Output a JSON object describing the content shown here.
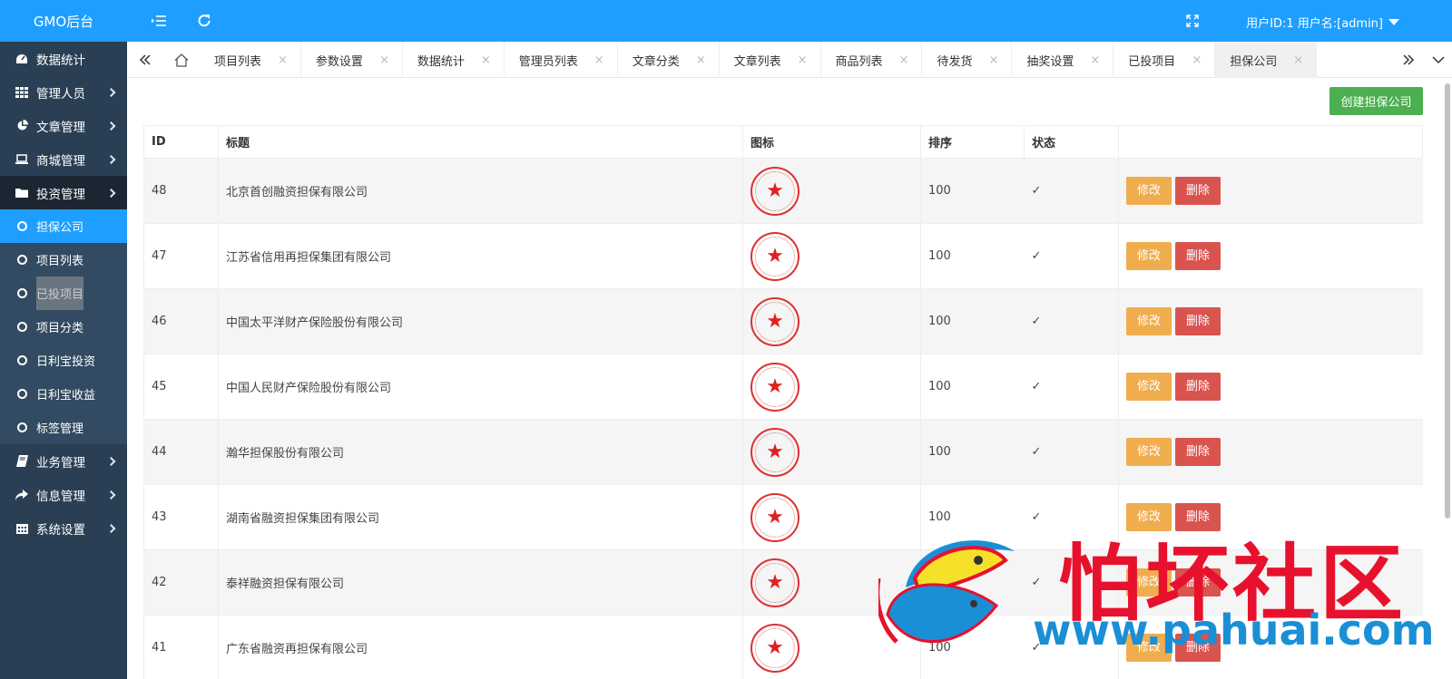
{
  "brand": "GMO后台",
  "header": {
    "user_info": "用户ID:1 用户名:[admin]"
  },
  "sidebar": {
    "items": [
      {
        "label": "数据统计",
        "icon": "dashboard-icon",
        "has_children": false
      },
      {
        "label": "管理人员",
        "icon": "grid-icon",
        "has_children": true
      },
      {
        "label": "文章管理",
        "icon": "pie-chart-icon",
        "has_children": true
      },
      {
        "label": "商城管理",
        "icon": "laptop-icon",
        "has_children": true
      },
      {
        "label": "投资管理",
        "icon": "folder-icon",
        "has_children": true,
        "open": true
      }
    ],
    "sub_items": [
      {
        "label": "担保公司",
        "active": true
      },
      {
        "label": "项目列表"
      },
      {
        "label": "已投项目",
        "highlighted": true
      },
      {
        "label": "项目分类"
      },
      {
        "label": "日利宝投资"
      },
      {
        "label": "日利宝收益"
      },
      {
        "label": "标签管理"
      }
    ],
    "items_after": [
      {
        "label": "业务管理",
        "icon": "book-icon",
        "has_children": true
      },
      {
        "label": "信息管理",
        "icon": "share-icon",
        "has_children": true
      },
      {
        "label": "系统设置",
        "icon": "calendar-icon",
        "has_children": true
      }
    ]
  },
  "tabs": [
    "项目列表",
    "参数设置",
    "数据统计",
    "管理员列表",
    "文章分类",
    "文章列表",
    "商品列表",
    "待发货",
    "抽奖设置",
    "已投项目",
    "担保公司"
  ],
  "active_tab": "担保公司",
  "tab_close": "×",
  "create_button": "创建担保公司",
  "table": {
    "columns": [
      "ID",
      "标题",
      "图标",
      "排序",
      "状态",
      ""
    ],
    "rows": [
      {
        "id": "48",
        "title": "北京首创融资担保有限公司",
        "sort": "100",
        "status": "✓"
      },
      {
        "id": "47",
        "title": "江苏省信用再担保集团有限公司",
        "sort": "100",
        "status": "✓"
      },
      {
        "id": "46",
        "title": "中国太平洋财产保险股份有限公司",
        "sort": "100",
        "status": "✓"
      },
      {
        "id": "45",
        "title": "中国人民财产保险股份有限公司",
        "sort": "100",
        "status": "✓"
      },
      {
        "id": "44",
        "title": "瀚华担保股份有限公司",
        "sort": "100",
        "status": "✓"
      },
      {
        "id": "43",
        "title": "湖南省融资担保集团有限公司",
        "sort": "100",
        "status": "✓"
      },
      {
        "id": "42",
        "title": "泰祥融资担保有限公司",
        "sort": "100",
        "status": "✓"
      },
      {
        "id": "41",
        "title": "广东省融资再担保有限公司",
        "sort": "100",
        "status": "✓"
      }
    ],
    "edit_label": "修改",
    "delete_label": "删除"
  },
  "watermark": {
    "text": "怕坏社区",
    "url": "www.pahuai.com"
  },
  "colors": {
    "primary": "#1e9fff",
    "sidebar": "#2a3f54",
    "success": "#4caf50",
    "warning": "#f0ad4e",
    "danger": "#d9534f",
    "seal": "#e03030"
  }
}
